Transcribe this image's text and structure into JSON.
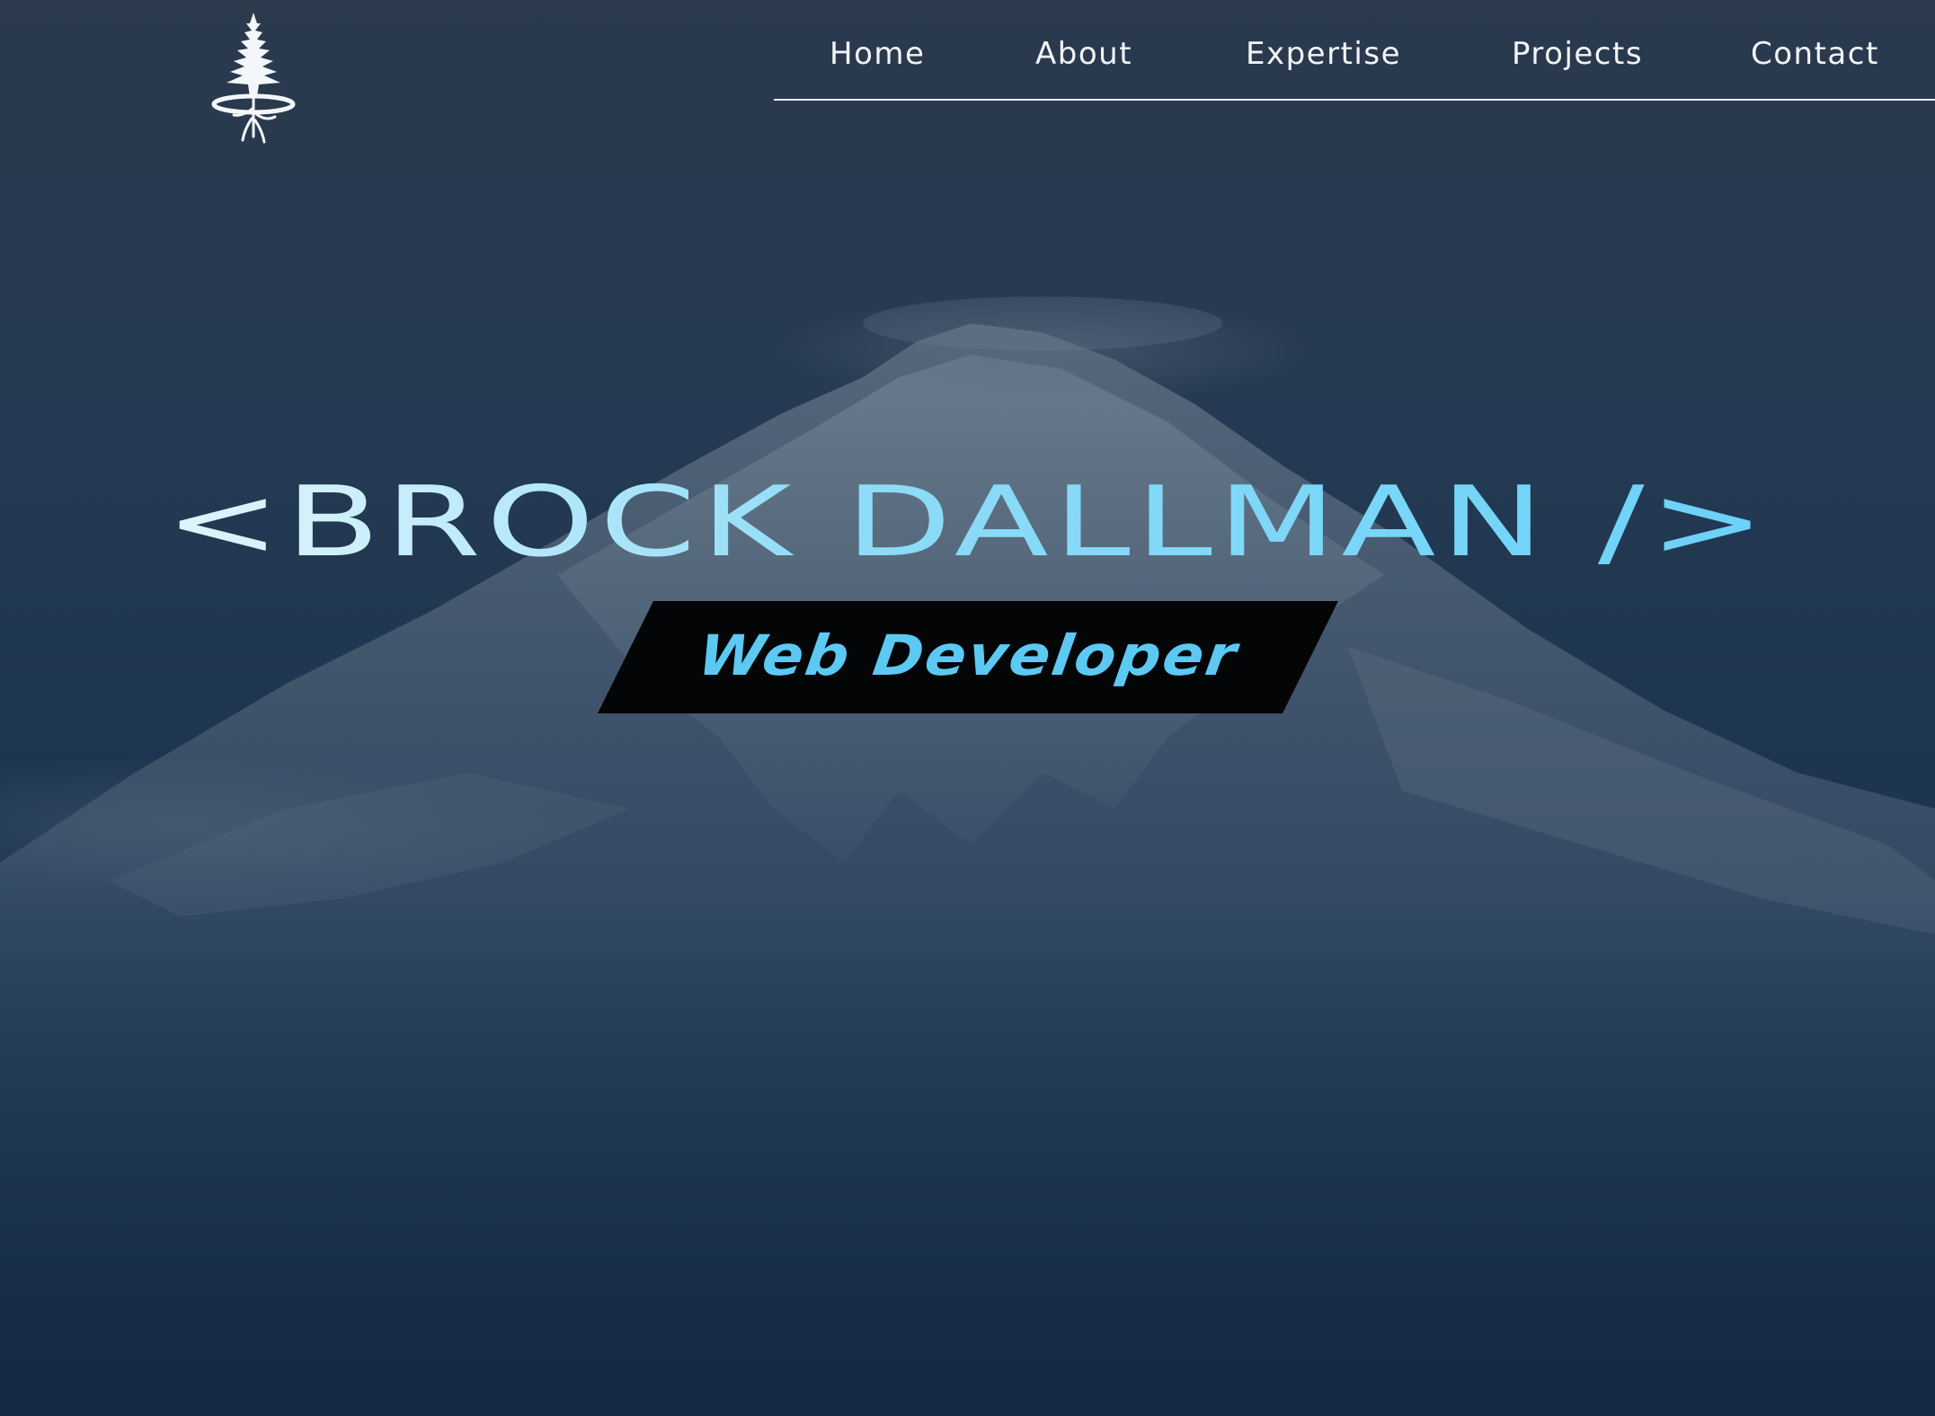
{
  "logo": {
    "icon": "evergreen-tree-with-roots-icon"
  },
  "nav": {
    "items": [
      {
        "label": "Home"
      },
      {
        "label": "About"
      },
      {
        "label": "Expertise"
      },
      {
        "label": "Projects"
      },
      {
        "label": "Contact"
      }
    ]
  },
  "hero": {
    "title": "<BROCK DALLMAN />",
    "subtitle": "Web Developer",
    "background": "snow-capped-mountain-photo"
  },
  "colors": {
    "accent": "#5cc9f2",
    "nav_text": "#f2f5f8",
    "subtitle_plate": "#030507",
    "background_dark": "#142a42"
  }
}
